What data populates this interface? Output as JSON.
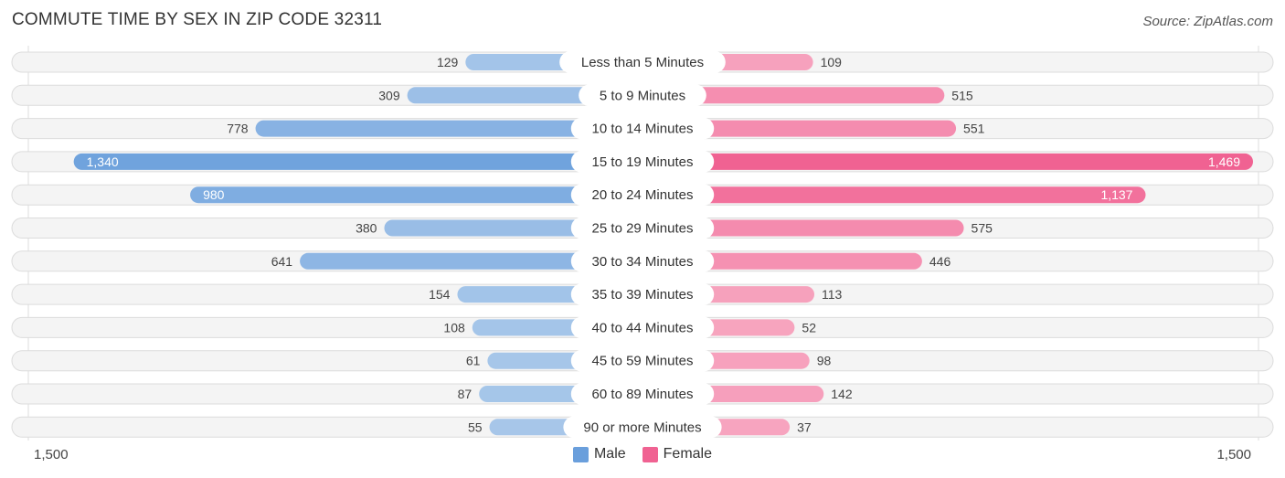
{
  "title": "COMMUTE TIME BY SEX IN ZIP CODE 32311",
  "source": "Source: ZipAtlas.com",
  "colors": {
    "male": "#6a9fdc",
    "female": "#f06292",
    "male_light": "#a9c8ea",
    "female_light": "#f7a6c0"
  },
  "chart_data": {
    "type": "bar",
    "orientation": "horizontal-diverging",
    "title": "COMMUTE TIME BY SEX IN ZIP CODE 32311",
    "categories": [
      "Less than 5 Minutes",
      "5 to 9 Minutes",
      "10 to 14 Minutes",
      "15 to 19 Minutes",
      "20 to 24 Minutes",
      "25 to 29 Minutes",
      "30 to 34 Minutes",
      "35 to 39 Minutes",
      "40 to 44 Minutes",
      "45 to 59 Minutes",
      "60 to 89 Minutes",
      "90 or more Minutes"
    ],
    "series": [
      {
        "name": "Male",
        "values": [
          129,
          309,
          778,
          1340,
          980,
          380,
          641,
          154,
          108,
          61,
          87,
          55
        ]
      },
      {
        "name": "Female",
        "values": [
          109,
          515,
          551,
          1469,
          1137,
          575,
          446,
          113,
          52,
          98,
          142,
          37
        ]
      }
    ],
    "axis_min_label": "1,500",
    "axis_max_label": "1,500",
    "xlim": [
      -1500,
      1500
    ],
    "legend_position": "bottom-center"
  }
}
